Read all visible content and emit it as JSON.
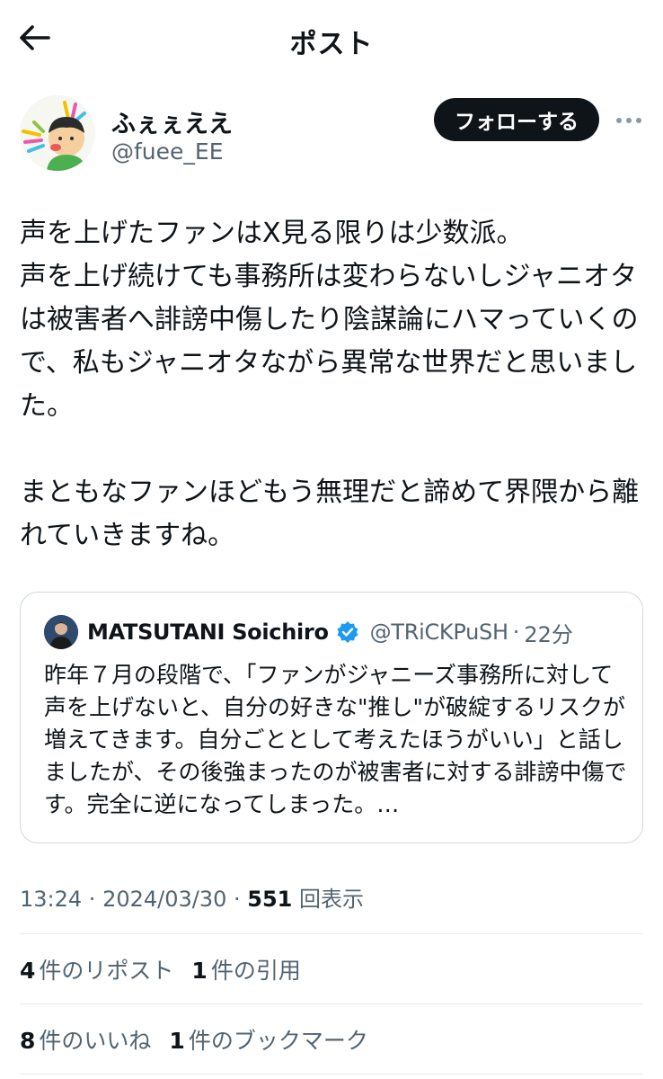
{
  "header": {
    "back_icon": "arrow-left-icon",
    "title": "ポスト"
  },
  "author": {
    "name": "ふぇぇええ",
    "handle": "@fuee_EE",
    "follow_label": "フォローする",
    "more_icon": "more-horizontal-icon"
  },
  "post": {
    "paragraphs": [
      "声を上げたファンはX見る限りは少数派。\n声を上げ続けても事務所は変わらないしジャニオタは被害者へ誹謗中傷したり陰謀論にハマっていくので、私もジャニオタながら異常な世界だと思いました。",
      "まともなファンほどもう無理だと諦めて界隈から離れていきますね。"
    ]
  },
  "quote": {
    "name": "MATSUTANI Soichiro",
    "verified_icon": "verified-badge-icon",
    "verified_color": "#1d9bf0",
    "handle": "@TRiCKPuSH",
    "sep": "·",
    "time": "22分",
    "text": "昨年７月の段階で、「ファンがジャニーズ事務所に対して声を上げないと、自分の好きな\"推し\"が破綻するリスクが増えてきます。自分ごととして考えたほうがいい」と話しましたが、その後強まったのが被害者に対する誹謗中傷です。完全に逆になってしまった。…"
  },
  "meta": {
    "time": "13:24",
    "sep1": " · ",
    "date": "2024/03/30",
    "sep2": " · ",
    "views_count": "551",
    "views_label": "回表示"
  },
  "stats_row1": [
    {
      "num": "4",
      "label": "件のリポスト"
    },
    {
      "num": "1",
      "label": "件の引用"
    }
  ],
  "stats_row2": [
    {
      "num": "8",
      "label": "件のいいね"
    },
    {
      "num": "1",
      "label": "件のブックマーク"
    }
  ]
}
